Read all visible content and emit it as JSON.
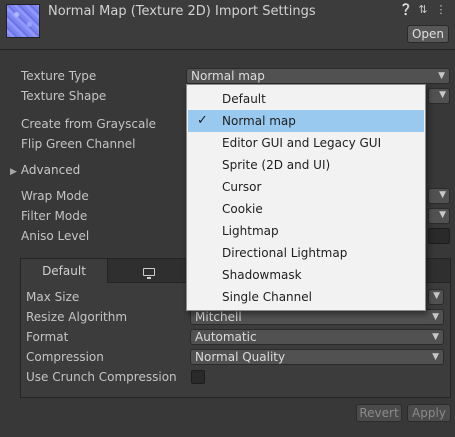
{
  "header": {
    "title": "Normal Map (Texture 2D) Import Settings",
    "open_label": "Open",
    "icons": [
      "help-icon",
      "preset-icon",
      "menu-icon"
    ]
  },
  "fields": {
    "texture_type": {
      "label": "Texture Type",
      "value": "Normal map"
    },
    "texture_shape": {
      "label": "Texture Shape"
    },
    "create_from_grayscale": {
      "label": "Create from Grayscale"
    },
    "flip_green_channel": {
      "label": "Flip Green Channel"
    },
    "advanced": {
      "label": "Advanced"
    },
    "wrap_mode": {
      "label": "Wrap Mode"
    },
    "filter_mode": {
      "label": "Filter Mode"
    },
    "aniso_level": {
      "label": "Aniso Level"
    }
  },
  "platform": {
    "tabs": [
      {
        "label": "Default"
      },
      {
        "icon": "monitor-icon"
      }
    ],
    "settings": {
      "max_size": {
        "label": "Max Size"
      },
      "resize_algorithm": {
        "label": "Resize Algorithm",
        "value": "Mitchell"
      },
      "format": {
        "label": "Format",
        "value": "Automatic"
      },
      "compression": {
        "label": "Compression",
        "value": "Normal Quality"
      },
      "use_crunch": {
        "label": "Use Crunch Compression",
        "checked": false
      }
    }
  },
  "footer": {
    "revert_label": "Revert",
    "apply_label": "Apply"
  },
  "texture_type_menu": {
    "selected": "Normal map",
    "items": [
      {
        "label": "Default"
      },
      {
        "label": "Normal map"
      },
      {
        "label": "Editor GUI and Legacy GUI"
      },
      {
        "label": "Sprite (2D and UI)"
      },
      {
        "label": "Cursor"
      },
      {
        "label": "Cookie"
      },
      {
        "label": "Lightmap"
      },
      {
        "label": "Directional Lightmap"
      },
      {
        "label": "Shadowmask"
      },
      {
        "label": "Single Channel"
      }
    ]
  },
  "colors": {
    "panel_bg": "#383838",
    "menu_bg": "#f2f2f2",
    "menu_highlight": "#99c9ef"
  }
}
